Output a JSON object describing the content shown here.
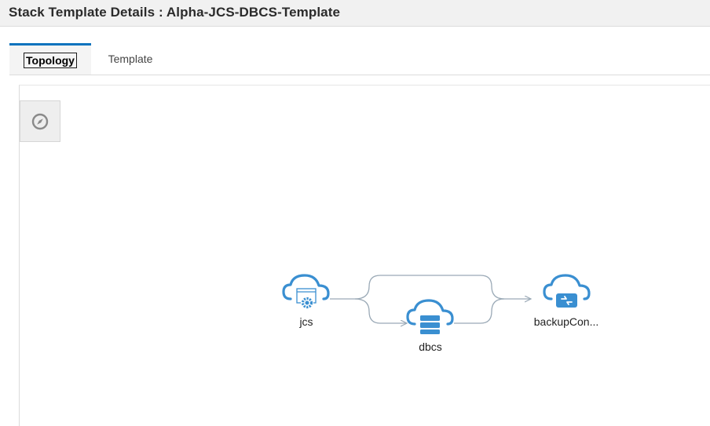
{
  "page": {
    "title": "Stack Template Details : Alpha-JCS-DBCS-Template"
  },
  "tabs": [
    {
      "label": "Topology",
      "active": true
    },
    {
      "label": "Template",
      "active": false
    }
  ],
  "toolbar": {
    "navigator_icon": "compass-icon"
  },
  "topology": {
    "nodes": [
      {
        "id": "jcs",
        "label": "jcs",
        "icon": "cloud-gear-icon"
      },
      {
        "id": "dbcs",
        "label": "dbcs",
        "icon": "cloud-database-icon"
      },
      {
        "id": "backup",
        "label": "backupCon...",
        "icon": "cloud-transfer-icon"
      }
    ],
    "edges": [
      {
        "from": "jcs",
        "to": "dbcs"
      },
      {
        "from": "jcs",
        "to": "backup"
      },
      {
        "from": "dbcs",
        "to": "backup"
      }
    ],
    "colors": {
      "icon": "#3a8fd1",
      "edge": "#9aa9b6"
    }
  }
}
